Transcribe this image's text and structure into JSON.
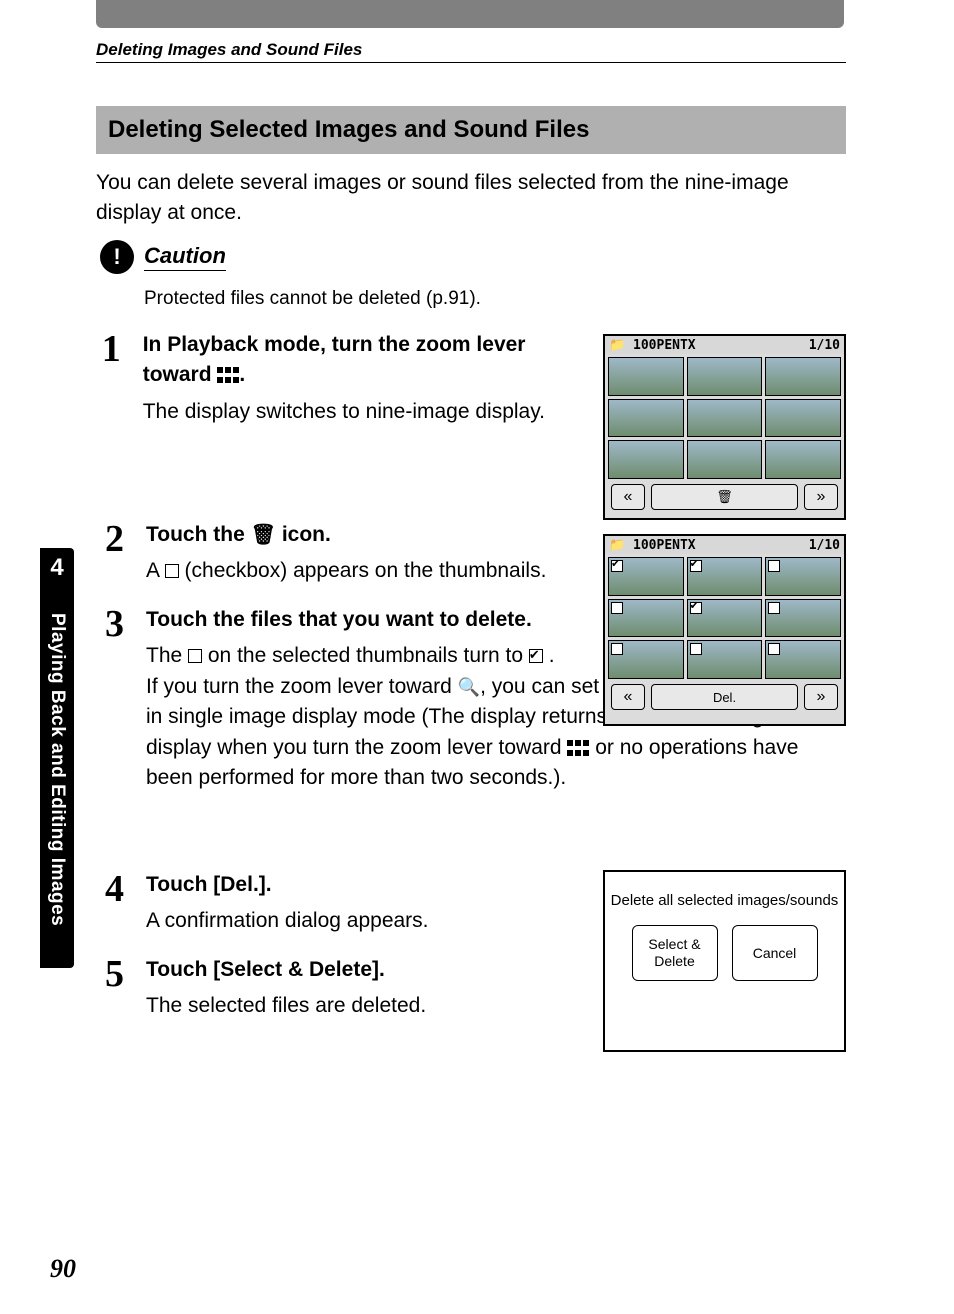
{
  "running_head": "Deleting Images and Sound Files",
  "subhead": "Deleting Selected Images and Sound Files",
  "intro": "You can delete several images or sound files selected from the nine-image display at once.",
  "caution": {
    "label": "Caution",
    "body": "Protected files cannot be deleted (p.91)."
  },
  "steps": {
    "s1": {
      "num": "1",
      "head_a": "In Playback mode, turn the zoom lever toward ",
      "head_b": ".",
      "body": "The display switches to nine-image display."
    },
    "s2": {
      "num": "2",
      "head_a": "Touch the ",
      "head_b": " icon.",
      "body_a": "A ",
      "body_b": " (checkbox) appears on the thumbnails."
    },
    "s3": {
      "num": "3",
      "head": "Touch the files that you want to delete.",
      "body1_a": "The ",
      "body1_b": " on the selected thumbnails turn to ",
      "body1_c": " .",
      "body2_a": "If you turn the zoom lever toward ",
      "body2_b": ", you can set the checkbox one by one in single image display mode (The display returns to the nine-image display when you turn the zoom lever toward ",
      "body2_c": " or no operations have been performed for more than two seconds.)."
    },
    "s4": {
      "num": "4",
      "head": "Touch [Del.].",
      "body": "A confirmation dialog appears."
    },
    "s5": {
      "num": "5",
      "head": "Touch [Select & Delete].",
      "body": "The selected files are deleted."
    }
  },
  "side": {
    "num": "4",
    "label": "Playing Back and Editing Images"
  },
  "pagenum": "90",
  "lcd": {
    "folder": "100PENTX",
    "counter": "1/10",
    "del_label": "Del."
  },
  "confirm": {
    "msg": "Delete all selected images/sounds",
    "select_delete": "Select & Delete",
    "cancel": "Cancel"
  }
}
